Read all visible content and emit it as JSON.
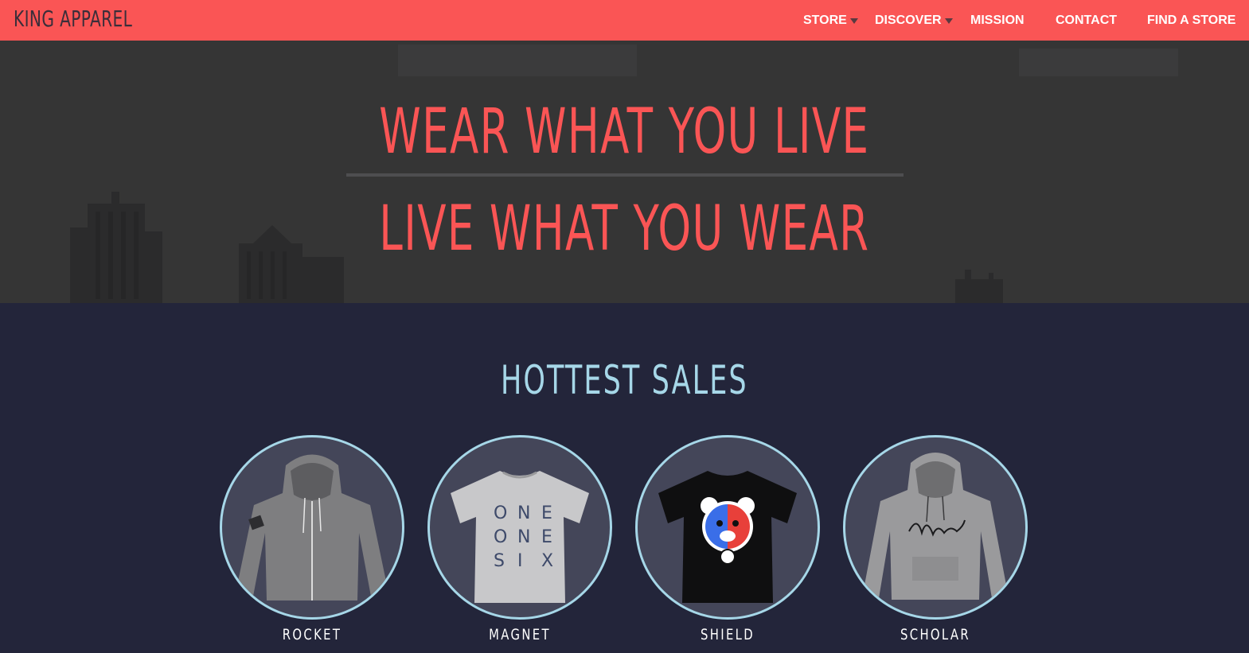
{
  "brand": "KING APPAREL",
  "nav": {
    "items": [
      {
        "label": "STORE",
        "dropdown": true
      },
      {
        "label": "DISCOVER",
        "dropdown": true
      },
      {
        "label": "MISSION",
        "dropdown": false
      },
      {
        "label": "CONTACT",
        "dropdown": false
      },
      {
        "label": "FIND A STORE",
        "dropdown": false
      }
    ]
  },
  "hero": {
    "line1": "WEAR WHAT YOU LIVE",
    "line2": "LIVE WHAT YOU WEAR"
  },
  "sales": {
    "title": "HOTTEST SALES",
    "products": [
      {
        "name": "ROCKET",
        "image": "grey-zip-hoodie"
      },
      {
        "name": "MAGNET",
        "image": "grey-graphic-tshirt"
      },
      {
        "name": "SHIELD",
        "image": "black-bear-tshirt"
      },
      {
        "name": "SCHOLAR",
        "image": "grey-script-hoodie"
      }
    ]
  },
  "colors": {
    "accent": "#fa5555",
    "navy": "#23253a",
    "light_blue": "#a6d7e8",
    "hero_bg": "#353535"
  }
}
